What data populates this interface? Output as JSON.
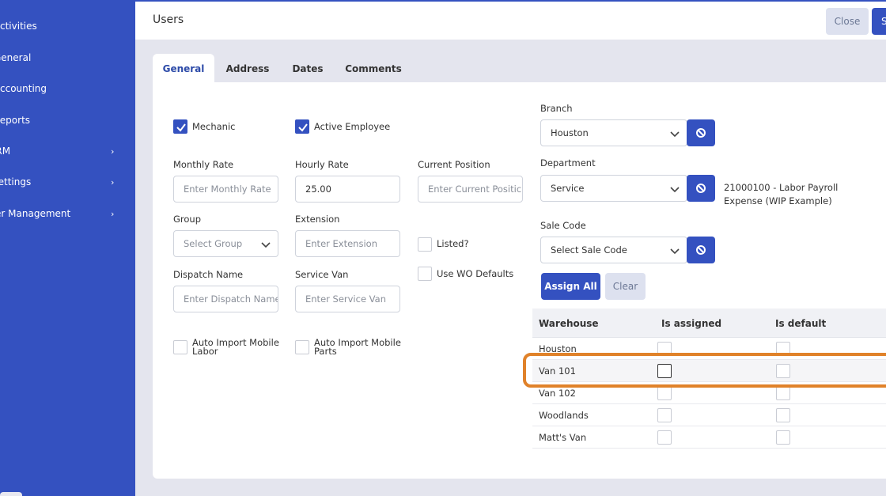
{
  "sidebar": {
    "items": [
      {
        "label": "Activities",
        "chevron": false
      },
      {
        "label": "General",
        "chevron": false
      },
      {
        "label": "Accounting",
        "chevron": false
      },
      {
        "label": "Reports",
        "chevron": false
      },
      {
        "label": "CRM",
        "chevron": true
      },
      {
        "label": "Settings",
        "chevron": true
      },
      {
        "label": "User Management",
        "chevron": true
      }
    ]
  },
  "header": {
    "title": "Users",
    "close_label": "Close",
    "save_label": "S"
  },
  "tabs": [
    "General",
    "Address",
    "Dates",
    "Comments"
  ],
  "active_tab": "General",
  "form": {
    "mechanic": {
      "label": "Mechanic",
      "checked": true
    },
    "active_employee": {
      "label": "Active Employee",
      "checked": true
    },
    "monthly_rate": {
      "label": "Monthly Rate",
      "placeholder": "Enter Monthly Rate",
      "value": ""
    },
    "hourly_rate": {
      "label": "Hourly Rate",
      "value": "25.00"
    },
    "current_position": {
      "label": "Current Position",
      "placeholder": "Enter Current Positic",
      "value": ""
    },
    "group": {
      "label": "Group",
      "selected": "Select Group"
    },
    "extension": {
      "label": "Extension",
      "placeholder": "Enter Extension"
    },
    "listed": {
      "label": "Listed?",
      "checked": false
    },
    "use_wo_defaults": {
      "label": "Use WO Defaults",
      "checked": false
    },
    "dispatch_name": {
      "label": "Dispatch Name",
      "placeholder": "Enter Dispatch Name"
    },
    "service_van": {
      "label": "Service Van",
      "placeholder": "Enter Service Van"
    },
    "auto_import_labor": {
      "label_line1": "Auto Import Mobile",
      "label_line2": "Labor",
      "checked": false
    },
    "auto_import_parts": {
      "label_line1": "Auto Import Mobile",
      "label_line2": "Parts",
      "checked": false
    },
    "branch": {
      "label": "Branch",
      "selected": "Houston"
    },
    "department": {
      "label": "Department",
      "selected": "Service",
      "note_line1": "21000100 - Labor Payroll",
      "note_line2": "Expense (WIP Example)"
    },
    "sale_code": {
      "label": "Sale Code",
      "selected": "Select Sale Code"
    },
    "assign_all_label": "Assign All",
    "clear_label": "Clear"
  },
  "warehouse_table": {
    "headers": [
      "Warehouse",
      "Is assigned",
      "Is default"
    ],
    "rows": [
      {
        "name": "Houston",
        "assigned": false,
        "default": false
      },
      {
        "name": "Van 101",
        "assigned": false,
        "default": false
      },
      {
        "name": "Van 102",
        "assigned": false,
        "default": false
      },
      {
        "name": "Woodlands",
        "assigned": false,
        "default": false
      },
      {
        "name": "Matt's Van",
        "assigned": false,
        "default": false
      }
    ],
    "highlighted_row": "Van 101"
  },
  "colors": {
    "primary": "#3451c0",
    "highlight_outline": "#e0822a"
  }
}
